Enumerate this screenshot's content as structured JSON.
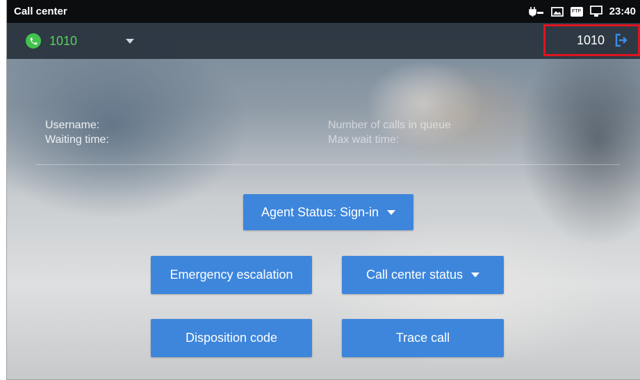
{
  "status_bar": {
    "title": "Call center",
    "time": "23:40",
    "icons": [
      "poe-icon",
      "image-icon",
      "ftp-icon",
      "monitor-icon"
    ],
    "ftp_text": "FTP"
  },
  "toolbar": {
    "account_number": "1010",
    "account_icon": "phone-icon",
    "signed_in_number": "1010",
    "logout_icon": "logout-icon",
    "accent_color": "#43c24d",
    "highlight_color": "#e0141e"
  },
  "info": {
    "username_label": "Username:",
    "waiting_label": "Waiting time:",
    "queue_label": "Number of calls in queue",
    "max_wait_label": "Max wait time:"
  },
  "buttons": {
    "agent_status": "Agent Status: Sign-in",
    "emergency": "Emergency escalation",
    "call_center_status": "Call center status",
    "disposition": "Disposition code",
    "trace": "Trace call",
    "color": "#3d86dc"
  }
}
